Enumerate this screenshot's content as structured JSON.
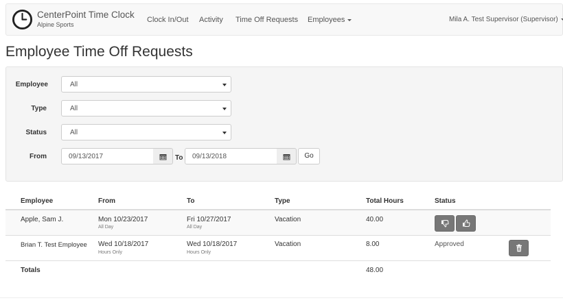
{
  "navbar": {
    "brand_title": "CenterPoint Time Clock",
    "brand_subtitle": "Alpine Sports",
    "items": [
      {
        "label": "Clock In/Out"
      },
      {
        "label": "Activity"
      },
      {
        "label": "Time Off Requests"
      },
      {
        "label": "Employees",
        "dropdown": true
      }
    ],
    "user_menu": "Mila A. Test Supervisor (Supervisor)",
    "logo_icon": "clock-icon"
  },
  "page": {
    "title": "Employee Time Off Requests"
  },
  "filters": {
    "employee": {
      "label": "Employee",
      "value": "All"
    },
    "type": {
      "label": "Type",
      "value": "All"
    },
    "status": {
      "label": "Status",
      "value": "All"
    },
    "from": {
      "label": "From",
      "value": "09/13/2017"
    },
    "to": {
      "label": "To",
      "value": "09/13/2018"
    },
    "go_label": "Go",
    "calendar_icon": "calendar-icon"
  },
  "table": {
    "columns": [
      "Employee",
      "From",
      "To",
      "Type",
      "Total Hours",
      "Status"
    ],
    "rows": [
      {
        "employee": "Apple, Sam J.",
        "from": "Mon 10/23/2017",
        "from_sub": "All Day",
        "to": "Fri 10/27/2017",
        "to_sub": "All Day",
        "type": "Vacation",
        "hours": "40.00",
        "status": "",
        "actions": [
          "thumbs-down-icon",
          "thumbs-up-icon"
        ]
      },
      {
        "employee": "Brian T. Test Employee",
        "from": "Wed 10/18/2017",
        "from_sub": "Hours Only",
        "to": "Wed 10/18/2017",
        "to_sub": "Hours Only",
        "type": "Vacation",
        "hours": "8.00",
        "status": "Approved",
        "actions": [
          "trash-icon"
        ]
      }
    ],
    "totals_label": "Totals",
    "totals_hours": "48.00"
  },
  "colors": {
    "action_button": "#777777",
    "header_bg": "#f8f8f8",
    "well_bg": "#f5f5f5"
  }
}
